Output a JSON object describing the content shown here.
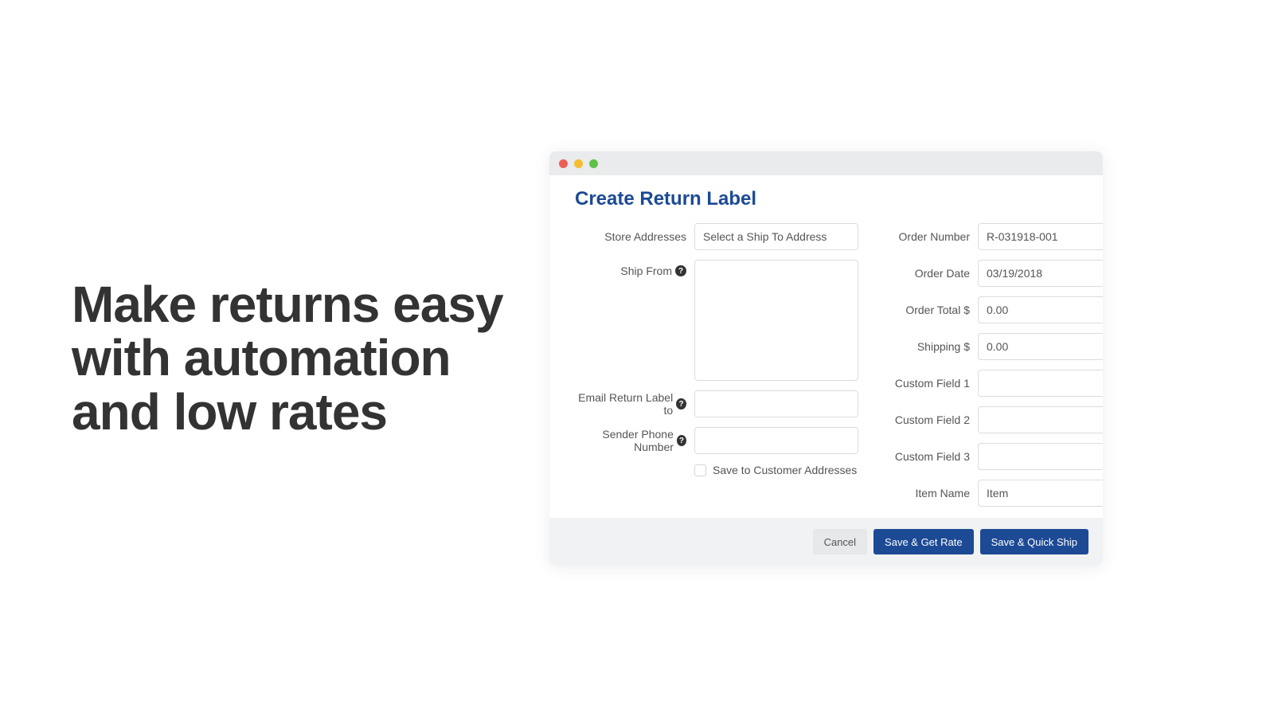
{
  "marketing": {
    "headline": "Make returns easy with automation and low rates"
  },
  "window": {
    "title": "Create Return Label"
  },
  "form": {
    "left": {
      "store_addresses_label": "Store Addresses",
      "store_addresses_value": "Select a Ship To Address",
      "ship_from_label": "Ship From",
      "ship_from_value": "",
      "email_label": "Email Return Label to",
      "email_value": "",
      "phone_label": "Sender Phone Number",
      "phone_value": "",
      "save_customer_label": "Save to Customer Addresses"
    },
    "right": {
      "order_number_label": "Order Number",
      "order_number_value": "R-031918-001",
      "order_date_label": "Order Date",
      "order_date_value": "03/19/2018",
      "order_total_label": "Order Total $",
      "order_total_value": "0.00",
      "shipping_label": "Shipping $",
      "shipping_value": "0.00",
      "custom1_label": "Custom Field 1",
      "custom1_value": "",
      "custom2_label": "Custom Field 2",
      "custom2_value": "",
      "custom3_label": "Custom Field 3",
      "custom3_value": "",
      "item_name_label": "Item Name",
      "item_name_value": "Item"
    }
  },
  "buttons": {
    "cancel": "Cancel",
    "save_rate": "Save & Get Rate",
    "save_ship": "Save & Quick Ship"
  }
}
